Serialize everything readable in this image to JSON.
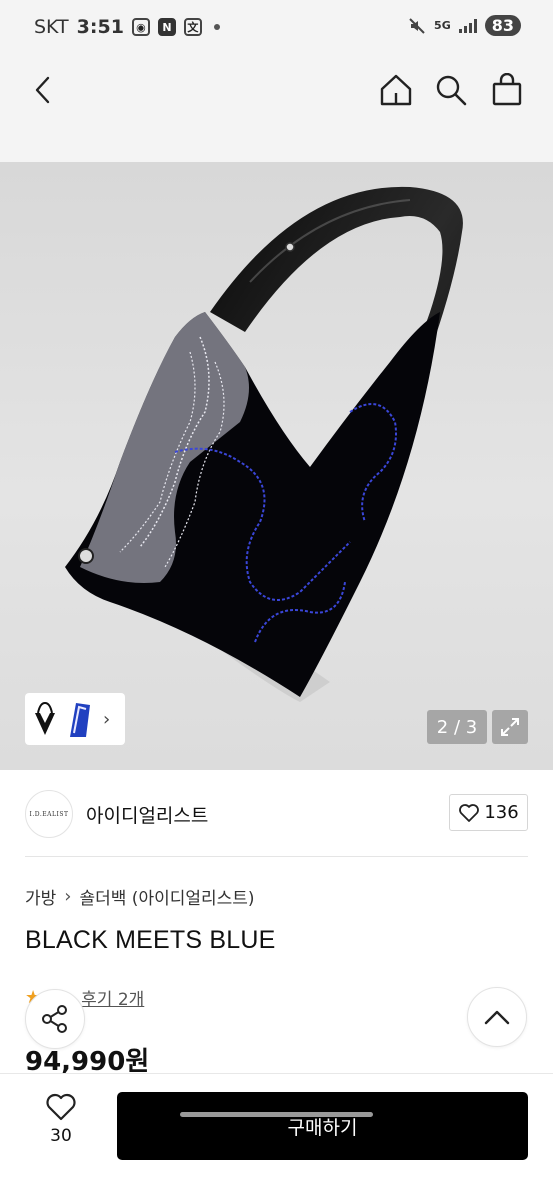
{
  "status_bar": {
    "carrier": "SKT",
    "time": "3:51",
    "icons": [
      "screen-record-icon",
      "naver-icon",
      "translate-icon"
    ],
    "network": "5G",
    "battery": "83"
  },
  "nav": {
    "icons": [
      "back-arrow-icon",
      "home-icon",
      "search-icon",
      "shopping-bag-icon"
    ]
  },
  "gallery": {
    "counter": "2 / 3",
    "current_index": 2,
    "total": 3
  },
  "brand": {
    "logo_text": "I.D.EALIST",
    "name": "아이디얼리스트",
    "like_count": "136"
  },
  "product": {
    "breadcrumb": [
      "가방",
      "숄더백 (아이디얼리스트)"
    ],
    "title": "BLACK MEETS BLUE",
    "reviews": "후기 2개",
    "price": "94,990원"
  },
  "bottom_bar": {
    "wish_count": "30",
    "buy_label": "구매하기"
  },
  "colors": {
    "buy_button": "#000000",
    "accent_star": "#f0a020",
    "page_bg": "#ffffff",
    "header_bg": "#f4f4f4"
  }
}
